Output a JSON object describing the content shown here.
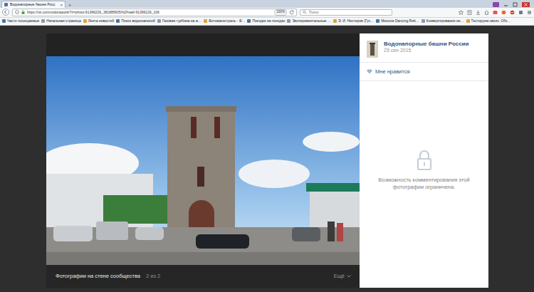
{
  "tabs": [
    {
      "label": "Водонапорные башни Росс",
      "close": "×",
      "selected": true
    }
  ],
  "new_tab": "+",
  "address": {
    "url": "https://vk.com/vodonaporki?z=photo-91396226_381885605%2Fwall-91396226_106",
    "zoom": "100%"
  },
  "search": {
    "placeholder": "Поиск"
  },
  "bookmarks": [
    "Часто посещаемые",
    "Начальная страница",
    "Лента новостей",
    "Поиск видеозаписей",
    "Газовая турбина на ж…",
    "Фотомагистраль - Ф…",
    "Поездки на поездах",
    "Экспериментальные …",
    "Э. И. Нестеров (Гус…",
    "Moscow Dancing Reb…",
    "Конвертирование не…",
    "Тестируем своих. Обз…"
  ],
  "viewer": {
    "caption": "Фотографии на стене сообщества",
    "counter": "2 из 2",
    "more": "Ещё",
    "group": "Водонапорные башни России",
    "date": "25 сен 2015",
    "like": "Мне нравится",
    "comments_notice": "Возможность комментирования этой фотографии ограничена."
  }
}
